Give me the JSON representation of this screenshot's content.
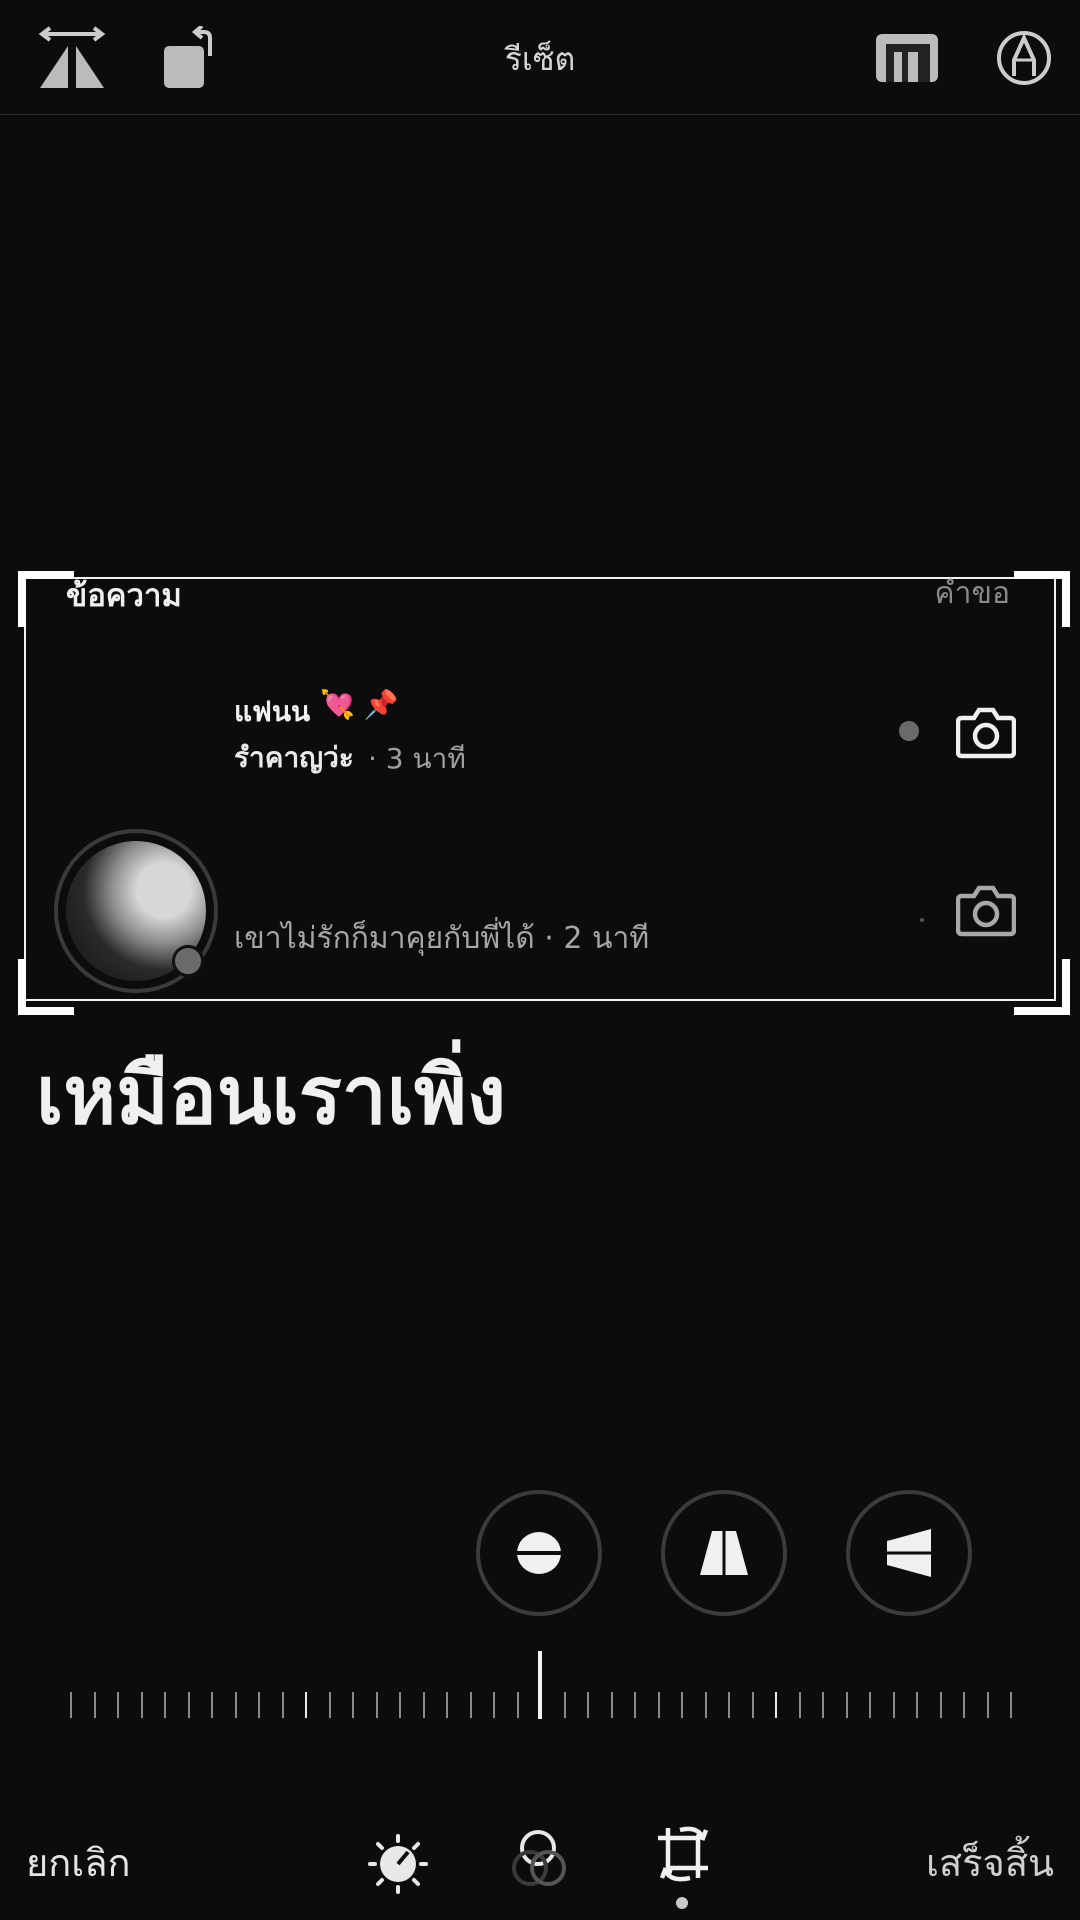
{
  "top_bar": {
    "title": "รีเซ็ต",
    "icons": [
      "flip-horizontal-icon",
      "rotate-icon",
      "aspect-ratio-icon",
      "markup-pen-icon"
    ]
  },
  "content": {
    "header_left": "ข้อความ",
    "header_right": "คำขอ",
    "chat1": {
      "name": "แฟนน",
      "name_emoji": "💘 📌",
      "last_message_bold": "รำคาญว่ะ",
      "time": "· 3 นาที"
    },
    "chat2": {
      "message_and_time": "เขาไม่รักก็มาคุยกับพี่ได้ · 2 นาที"
    },
    "overlay_text": "เหมือนเราเพิ่ง"
  },
  "perspective_buttons": [
    "straighten-icon",
    "vertical-perspective-icon",
    "horizontal-perspective-icon"
  ],
  "straighten_angle": 0,
  "bottom_bar": {
    "cancel_label": "ยกเลิก",
    "done_label": "เสร็จสิ้น",
    "tools": [
      "adjust-icon",
      "filters-icon",
      "crop-rotate-icon"
    ],
    "active_tool": "crop-rotate-icon"
  }
}
